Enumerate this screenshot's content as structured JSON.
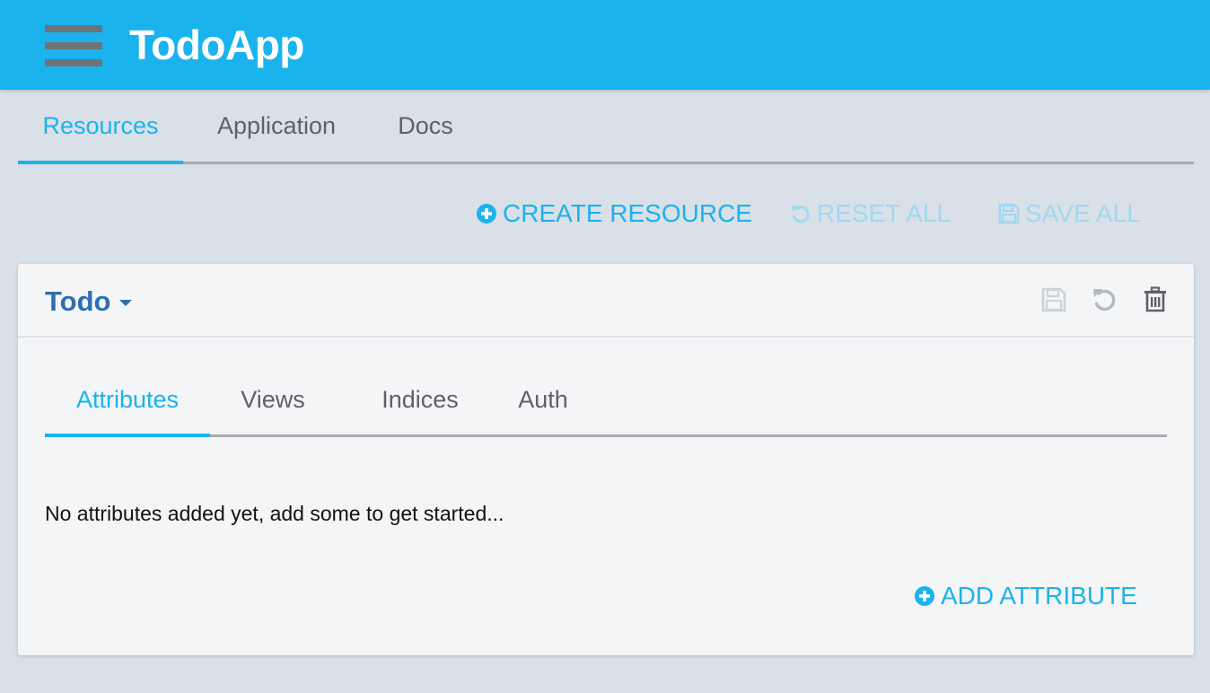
{
  "app": {
    "title": "TodoApp",
    "menu_icon": "hamburger-menu-icon"
  },
  "main_tabs": [
    {
      "label": "Resources",
      "active": true
    },
    {
      "label": "Application",
      "active": false
    },
    {
      "label": "Docs",
      "active": false
    }
  ],
  "actions": {
    "create": {
      "label": "CREATE RESOURCE",
      "icon": "plus-circle-icon",
      "enabled": true
    },
    "reset": {
      "label": "RESET ALL",
      "icon": "undo-icon",
      "enabled": false
    },
    "save": {
      "label": "SAVE ALL",
      "icon": "floppy-disk-icon",
      "enabled": false
    }
  },
  "resource": {
    "name": "Todo",
    "header_icons": [
      "floppy-disk-icon",
      "undo-icon",
      "trash-icon"
    ],
    "tabs": [
      {
        "label": "Attributes",
        "active": true
      },
      {
        "label": "Views",
        "active": false
      },
      {
        "label": "Indices",
        "active": false
      },
      {
        "label": "Auth",
        "active": false
      }
    ],
    "empty_message": "No attributes added yet, add some to get started...",
    "add_attribute_label": "ADD ATTRIBUTE"
  },
  "colors": {
    "accent": "#1ab3ed",
    "accent_disabled": "#9fd8f1",
    "resource_title": "#2d6fb0",
    "background": "#dae0e8",
    "card": "#f4f5f7",
    "tab_inactive": "#5f6166"
  }
}
